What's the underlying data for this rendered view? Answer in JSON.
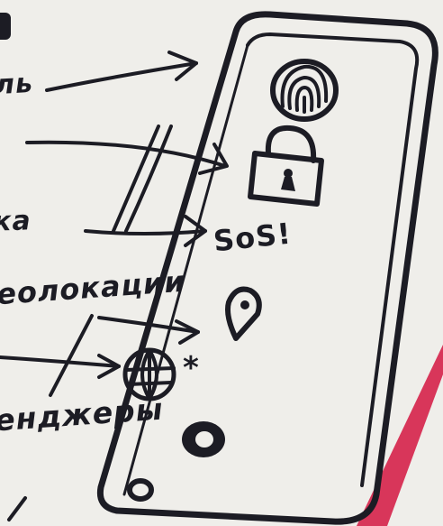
{
  "labels": {
    "item_1": "ль",
    "item_2": "ка",
    "item_3": "еолокации",
    "item_4": "енджеры"
  },
  "icons": {
    "sos_text": "SoS!",
    "star_glyph": "*"
  },
  "colors": {
    "background": "#efeeea",
    "ink": "#1c1c24",
    "accent_stripe": "#d8365a"
  },
  "icon_names": [
    "fingerprint-icon",
    "padlock-icon",
    "sos-text",
    "location-pin-icon",
    "globe-icon",
    "star-icon",
    "home-button-icon"
  ]
}
